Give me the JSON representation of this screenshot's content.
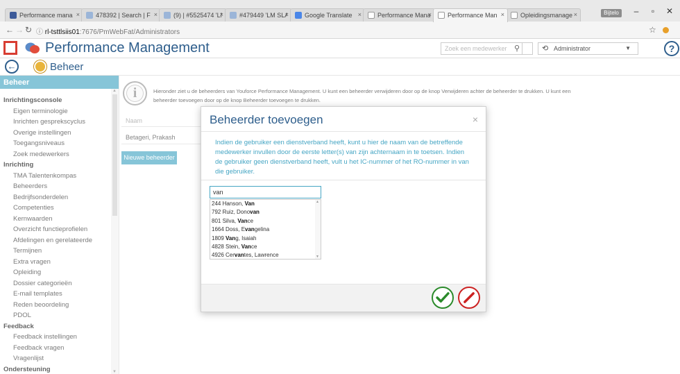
{
  "browser": {
    "tabs": [
      {
        "label": "Performance mana",
        "active": false
      },
      {
        "label": "478392 | Search | F",
        "active": false
      },
      {
        "label": "(9) | #5525474 'LM",
        "active": false
      },
      {
        "label": "#479449 'LM SLA",
        "active": false
      },
      {
        "label": "Google Translate",
        "active": false
      },
      {
        "label": "Performance Mana",
        "active": false
      },
      {
        "label": "Performance Man",
        "active": true
      },
      {
        "label": "Opleidingsmanage",
        "active": false
      }
    ],
    "profile_label": "Bijtelo",
    "url_host": "rl-tsttlsiis01",
    "url_path": ":7676/PmWebFat/Administrators"
  },
  "header": {
    "app_title": "Performance Management",
    "search_placeholder": "Zoek een medewerker",
    "role": "Administrator",
    "help_label": "?"
  },
  "subheader": {
    "title": "Beheer"
  },
  "sidebar": {
    "heading": "Beheer",
    "sections": [
      {
        "title": "Inrichtingsconsole",
        "items": [
          "Eigen terminologie",
          "Inrichten gesprekscyclus",
          "Overige instellingen",
          "Toegangsniveaus",
          "Zoek medewerkers"
        ]
      },
      {
        "title": "Inrichting",
        "items": [
          "TMA Talentenkompas",
          "Beheerders",
          "Bedrijfsonderdelen",
          "Competenties",
          "Kernwaarden",
          "Overzicht functieprofielen",
          "Afdelingen en gerelateerde",
          "Termijnen",
          "Extra vragen",
          "Opleiding",
          "Dossier categorieën",
          "E-mail templates",
          "Reden beoordeling",
          "PDOL"
        ]
      },
      {
        "title": "Feedback",
        "items": [
          "Feedback instellingen",
          "Feedback vragen",
          "Vragenlijst"
        ]
      },
      {
        "title": "Ondersteuning",
        "items": []
      }
    ]
  },
  "main": {
    "info_icon": "i",
    "info_text": "Hieronder ziet u de beheerders van Youforce Performance Management. U kunt een beheerder verwijderen door op de knop Verwijderen achter de beheerder te drukken. U kunt een beheerder toevoegen door op de knop Beheerder toevoegen te drukken.",
    "column_name": "Naam",
    "rows": [
      "Betageri, Prakash"
    ],
    "new_button": "Nieuwe beheerder"
  },
  "modal": {
    "title": "Beheerder toevoegen",
    "close": "×",
    "description": "Indien de gebruiker een dienstverband heeft, kunt u hier de naam van de betreffende medewerker invullen door de eerste letter(s) van zijn achternaam in te toetsen. Indien de gebruiker geen dienstverband heeft, vult u het IC-nummer of het RO-nummer in van die gebruiker.",
    "input_value": "van",
    "suggestions": [
      {
        "pre": "244 Hanson, ",
        "match": "Van",
        "post": ""
      },
      {
        "pre": "792 Ruiz, Dono",
        "match": "van",
        "post": ""
      },
      {
        "pre": "801 Silva, ",
        "match": "Van",
        "post": "ce"
      },
      {
        "pre": "1664 Doss, E",
        "match": "van",
        "post": "gelina"
      },
      {
        "pre": "1809 ",
        "match": "Van",
        "post": "g, Isaiah"
      },
      {
        "pre": "4828 Stein, ",
        "match": "Van",
        "post": "ce"
      },
      {
        "pre": "4926 Cer",
        "match": "van",
        "post": "tes, Lawrence"
      }
    ]
  },
  "colors": {
    "accent": "#46a6c4",
    "brand": "#2e5e8c",
    "ok": "#2a8a2a",
    "cancel": "#cc2222"
  }
}
